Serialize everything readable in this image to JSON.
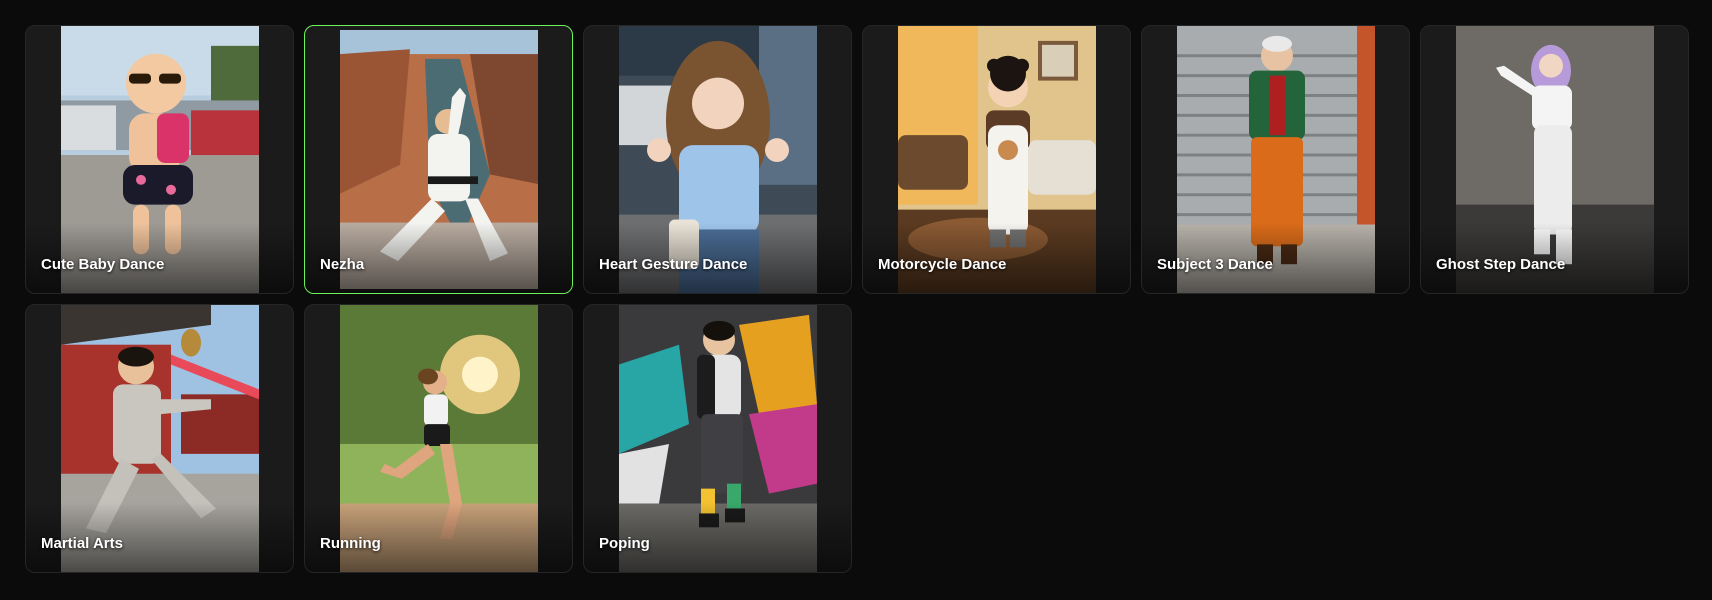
{
  "selected_index": 1,
  "accent_color": "#6cf25a",
  "templates": [
    {
      "label": "Cute Baby Dance",
      "icon": "baby-dance-thumbnail"
    },
    {
      "label": "Nezha",
      "icon": "nezha-thumbnail"
    },
    {
      "label": "Heart Gesture Dance",
      "icon": "heart-gesture-thumbnail"
    },
    {
      "label": "Motorcycle Dance",
      "icon": "motorcycle-dance-thumbnail"
    },
    {
      "label": "Subject 3 Dance",
      "icon": "subject-3-thumbnail"
    },
    {
      "label": "Ghost Step Dance",
      "icon": "ghost-step-thumbnail"
    },
    {
      "label": "Martial Arts",
      "icon": "martial-arts-thumbnail"
    },
    {
      "label": "Running",
      "icon": "running-thumbnail"
    },
    {
      "label": "Poping",
      "icon": "poping-thumbnail"
    }
  ]
}
